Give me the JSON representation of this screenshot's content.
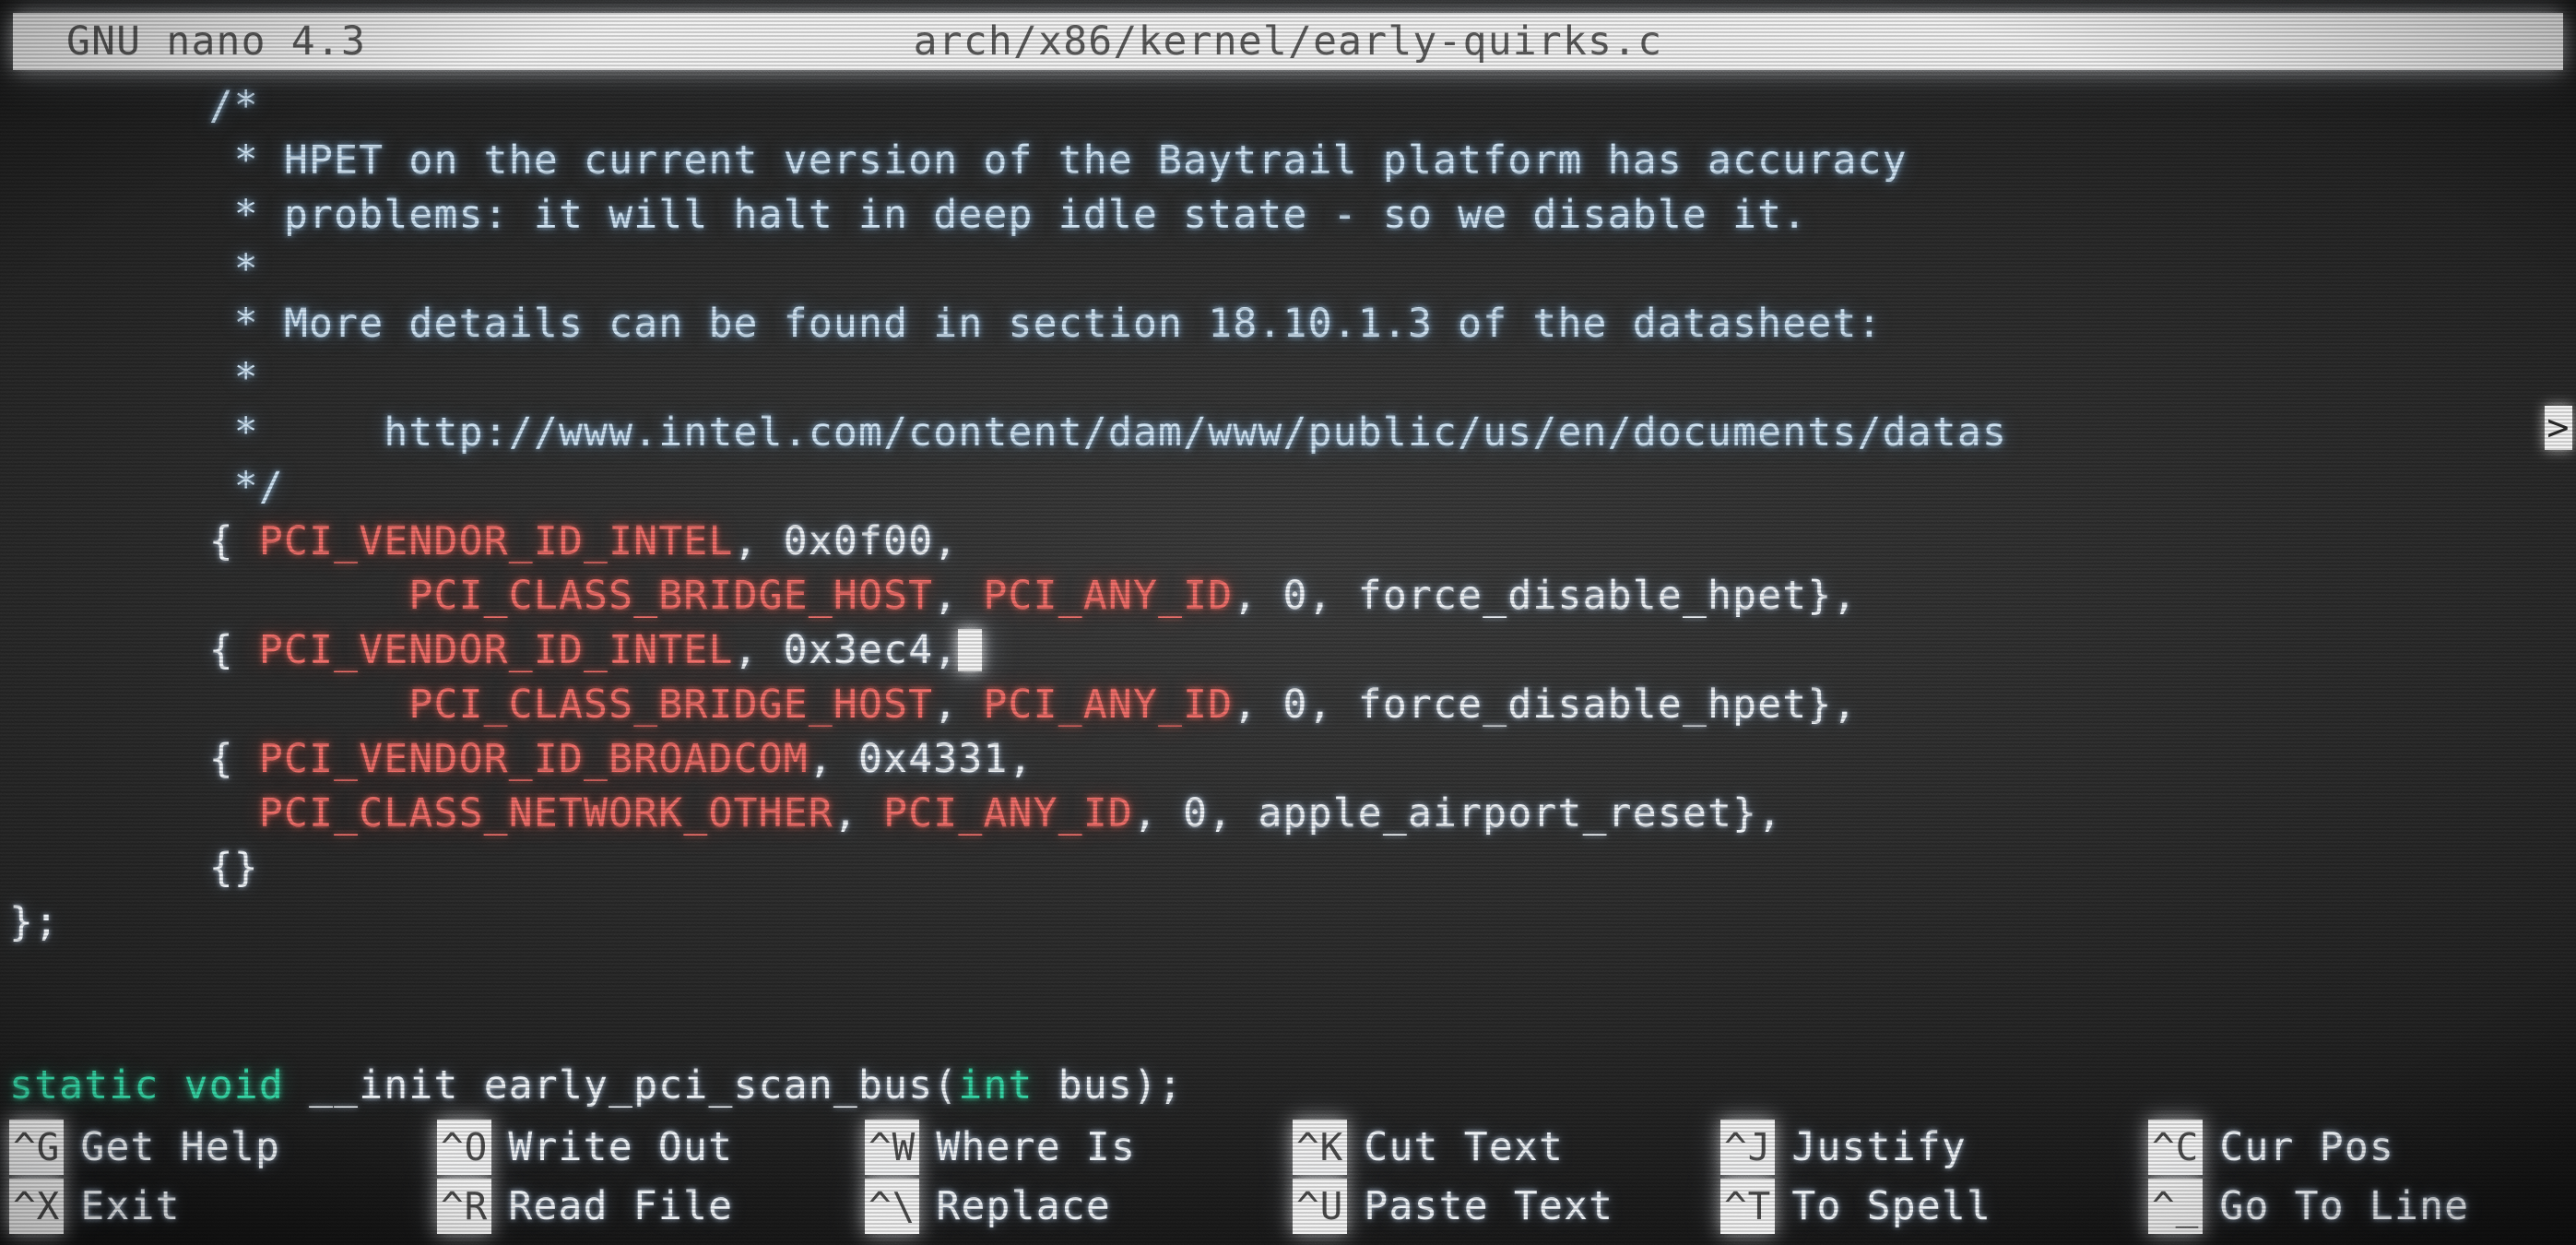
{
  "titlebar": {
    "version": "GNU nano 4.3",
    "filename": "arch/x86/kernel/early-quirks.c"
  },
  "editor": {
    "overflow_marker": ">",
    "cursor_char": " ",
    "lines": [
      {
        "id": "l1",
        "indent": "        ",
        "segments": [
          {
            "text": "/*",
            "color": "comment"
          }
        ]
      },
      {
        "id": "l2",
        "indent": "         ",
        "segments": [
          {
            "text": "* HPET on the current version of the Baytrail platform has accuracy",
            "color": "comment"
          }
        ]
      },
      {
        "id": "l3",
        "indent": "         ",
        "segments": [
          {
            "text": "* problems: it will halt in deep idle state - so we disable it.",
            "color": "comment"
          }
        ]
      },
      {
        "id": "l4",
        "indent": "         ",
        "segments": [
          {
            "text": "*",
            "color": "comment"
          }
        ]
      },
      {
        "id": "l5",
        "indent": "         ",
        "segments": [
          {
            "text": "* More details can be found in section 18.10.1.3 of the datasheet:",
            "color": "comment"
          }
        ]
      },
      {
        "id": "l6",
        "indent": "         ",
        "segments": [
          {
            "text": "*",
            "color": "comment"
          }
        ]
      },
      {
        "id": "l7",
        "indent": "         ",
        "segments": [
          {
            "text": "*     http://www.intel.com/content/dam/www/public/us/en/documents/datas",
            "color": "comment"
          }
        ],
        "overflow": true
      },
      {
        "id": "l8",
        "indent": "         ",
        "segments": [
          {
            "text": "*/",
            "color": "comment"
          }
        ]
      },
      {
        "id": "l9",
        "indent": "        ",
        "segments": [
          {
            "text": "{ ",
            "color": "white"
          },
          {
            "text": "PCI_VENDOR_ID_INTEL",
            "color": "red"
          },
          {
            "text": ", 0x0f00,",
            "color": "white"
          }
        ]
      },
      {
        "id": "l10",
        "indent": "                ",
        "segments": [
          {
            "text": "PCI_CLASS_BRIDGE_HOST",
            "color": "red"
          },
          {
            "text": ", ",
            "color": "white"
          },
          {
            "text": "PCI_ANY_ID",
            "color": "red"
          },
          {
            "text": ", 0, force_disable_hpet},",
            "color": "white"
          }
        ]
      },
      {
        "id": "l11",
        "indent": "        ",
        "segments": [
          {
            "text": "{ ",
            "color": "white"
          },
          {
            "text": "PCI_VENDOR_ID_INTEL",
            "color": "red"
          },
          {
            "text": ", 0x3ec4,",
            "color": "white"
          }
        ],
        "cursor_after": true
      },
      {
        "id": "l12",
        "indent": "                ",
        "segments": [
          {
            "text": "PCI_CLASS_BRIDGE_HOST",
            "color": "red"
          },
          {
            "text": ", ",
            "color": "white"
          },
          {
            "text": "PCI_ANY_ID",
            "color": "red"
          },
          {
            "text": ", 0, force_disable_hpet},",
            "color": "white"
          }
        ]
      },
      {
        "id": "l13",
        "indent": "        ",
        "segments": [
          {
            "text": "{ ",
            "color": "white"
          },
          {
            "text": "PCI_VENDOR_ID_BROADCOM",
            "color": "red"
          },
          {
            "text": ", 0x4331,",
            "color": "white"
          }
        ]
      },
      {
        "id": "l14",
        "indent": "          ",
        "segments": [
          {
            "text": "PCI_CLASS_NETWORK_OTHER",
            "color": "red"
          },
          {
            "text": ", ",
            "color": "white"
          },
          {
            "text": "PCI_ANY_ID",
            "color": "red"
          },
          {
            "text": ", 0, apple_airport_reset},",
            "color": "white"
          }
        ]
      },
      {
        "id": "l15",
        "indent": "        ",
        "segments": [
          {
            "text": "{}",
            "color": "white"
          }
        ]
      },
      {
        "id": "l16",
        "indent": "",
        "segments": [
          {
            "text": "};",
            "color": "white"
          }
        ]
      },
      {
        "id": "l17",
        "indent": "",
        "segments": []
      },
      {
        "id": "l18",
        "indent": "",
        "segments": []
      },
      {
        "id": "l19",
        "indent": "",
        "segments": [
          {
            "text": "static void",
            "color": "green"
          },
          {
            "text": " __init early_pci_scan_bus(",
            "color": "white"
          },
          {
            "text": "int",
            "color": "green"
          },
          {
            "text": " bus);",
            "color": "white"
          }
        ]
      }
    ]
  },
  "helpbar": {
    "rows": [
      [
        {
          "key": "^G",
          "label": "Get Help"
        },
        {
          "key": "^O",
          "label": "Write Out"
        },
        {
          "key": "^W",
          "label": "Where Is"
        },
        {
          "key": "^K",
          "label": "Cut Text"
        },
        {
          "key": "^J",
          "label": "Justify"
        },
        {
          "key": "^C",
          "label": "Cur Pos"
        }
      ],
      [
        {
          "key": "^X",
          "label": "Exit"
        },
        {
          "key": "^R",
          "label": "Read File"
        },
        {
          "key": "^\\",
          "label": "Replace"
        },
        {
          "key": "^U",
          "label": "Paste Text"
        },
        {
          "key": "^T",
          "label": "To Spell"
        },
        {
          "key": "^_",
          "label": "Go To Line"
        }
      ]
    ]
  },
  "colors": {
    "comment": "#cfe3f2",
    "white": "#eef2f6",
    "red": "#f0706b",
    "green": "#36d6a6",
    "background": "#1c1c1c",
    "inverse_bg": "#f2f2f2",
    "inverse_fg": "#5a5a5a"
  }
}
